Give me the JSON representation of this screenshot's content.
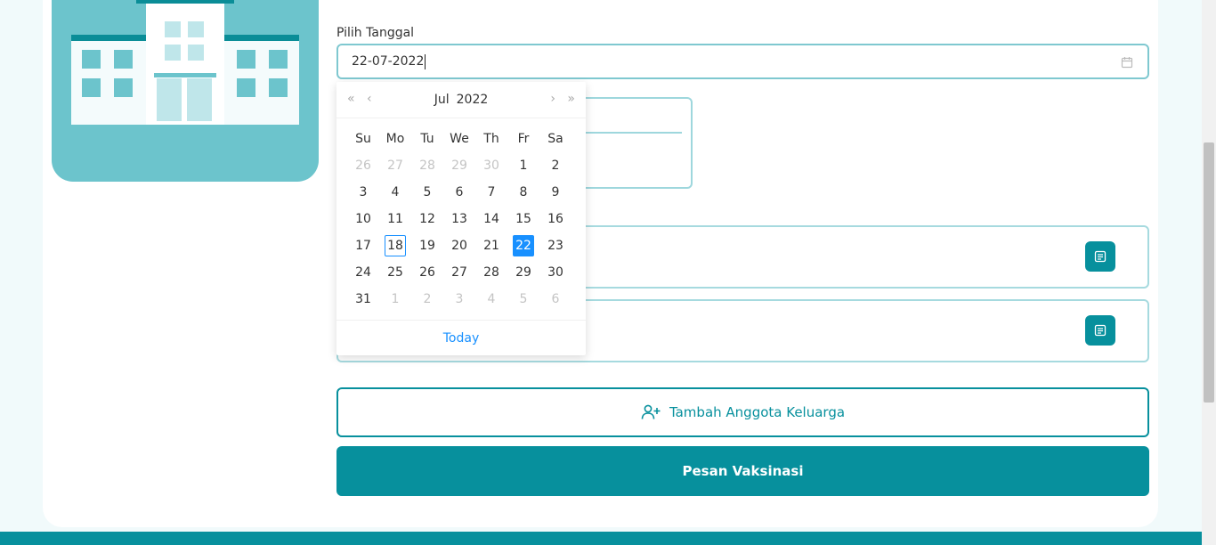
{
  "form": {
    "date_label": "Pilih Tanggal",
    "date_value": "22-07-2022"
  },
  "calendar": {
    "month": "Jul",
    "year": "2022",
    "weekdays": [
      "Su",
      "Mo",
      "Tu",
      "We",
      "Th",
      "Fr",
      "Sa"
    ],
    "days": [
      {
        "d": "26",
        "out": true
      },
      {
        "d": "27",
        "out": true
      },
      {
        "d": "28",
        "out": true
      },
      {
        "d": "29",
        "out": true
      },
      {
        "d": "30",
        "out": true
      },
      {
        "d": "1"
      },
      {
        "d": "2"
      },
      {
        "d": "3"
      },
      {
        "d": "4"
      },
      {
        "d": "5"
      },
      {
        "d": "6"
      },
      {
        "d": "7"
      },
      {
        "d": "8"
      },
      {
        "d": "9"
      },
      {
        "d": "10"
      },
      {
        "d": "11"
      },
      {
        "d": "12"
      },
      {
        "d": "13"
      },
      {
        "d": "14"
      },
      {
        "d": "15"
      },
      {
        "d": "16"
      },
      {
        "d": "17"
      },
      {
        "d": "18",
        "today": true
      },
      {
        "d": "19"
      },
      {
        "d": "20"
      },
      {
        "d": "21"
      },
      {
        "d": "22",
        "selected": true
      },
      {
        "d": "23"
      },
      {
        "d": "24"
      },
      {
        "d": "25"
      },
      {
        "d": "26"
      },
      {
        "d": "27"
      },
      {
        "d": "28"
      },
      {
        "d": "29"
      },
      {
        "d": "30"
      },
      {
        "d": "31"
      },
      {
        "d": "1",
        "out": true
      },
      {
        "d": "2",
        "out": true
      },
      {
        "d": "3",
        "out": true
      },
      {
        "d": "4",
        "out": true
      },
      {
        "d": "5",
        "out": true
      },
      {
        "d": "6",
        "out": true
      }
    ],
    "today_label": "Today"
  },
  "partial_text": "l",
  "actions": {
    "add_member_label": "Tambah Anggota Keluarga",
    "book_label": "Pesan Vaksinasi"
  },
  "colors": {
    "primary": "#07909d",
    "hero_bg": "#6cc4cc",
    "selected_day": "#1890ff"
  },
  "icons": [
    "calendar-icon",
    "user-plus-icon",
    "document-icon",
    "double-chevron-left-icon",
    "chevron-left-icon",
    "chevron-right-icon",
    "double-chevron-right-icon"
  ]
}
